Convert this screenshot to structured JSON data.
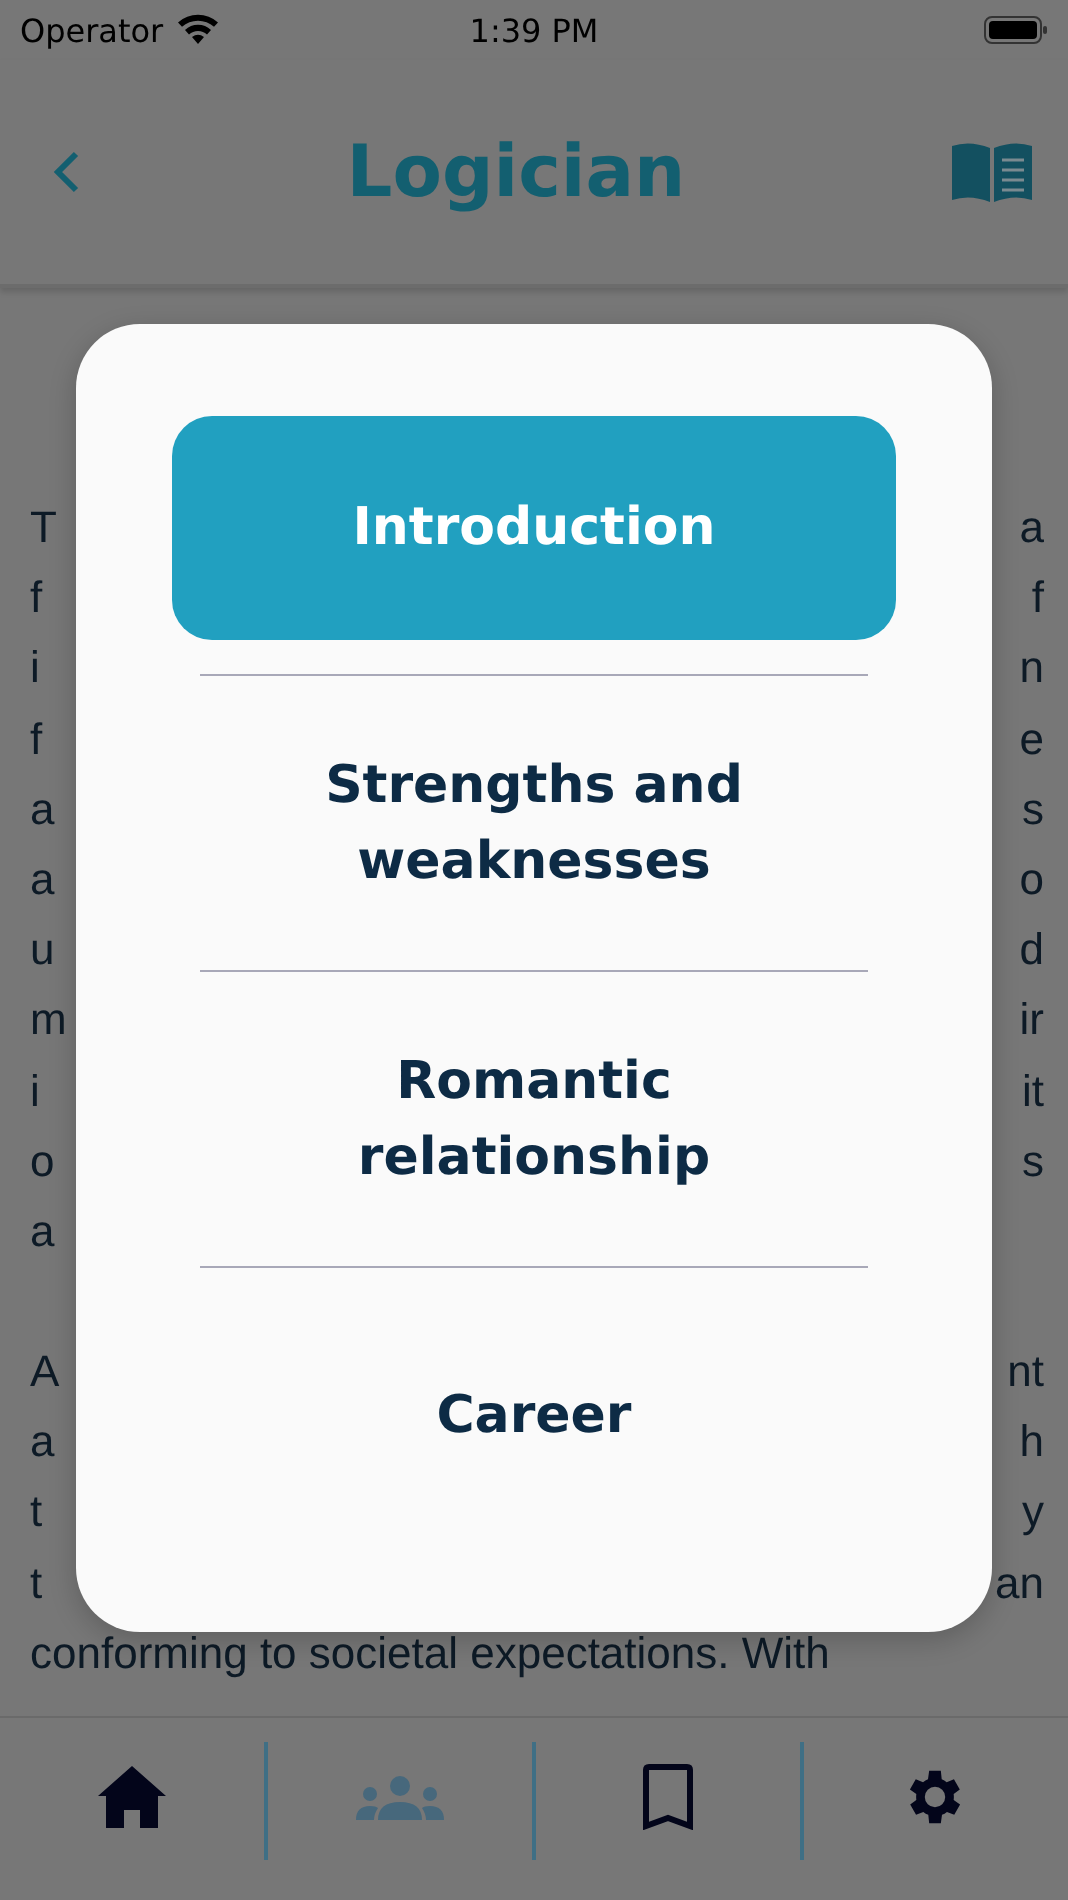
{
  "status_bar": {
    "carrier": "Operator",
    "time": "1:39 PM"
  },
  "header": {
    "title": "Logician"
  },
  "article": {
    "paragraphs": [
      {
        "lines": [
          {
            "left": "T",
            "right": "a"
          },
          {
            "left": "f",
            "right": "f"
          },
          {
            "left": "i",
            "right": "n"
          },
          {
            "left": "f",
            "right": "e"
          },
          {
            "left": "a",
            "right": "s"
          },
          {
            "left": "a",
            "right": "o"
          },
          {
            "left": "u",
            "right": "d"
          },
          {
            "left": "m",
            "right": "ir"
          },
          {
            "left": "i",
            "right": "it"
          },
          {
            "left": "o",
            "right": "s"
          },
          {
            "left": "a"
          }
        ]
      },
      {
        "lines": [
          {
            "left": "A",
            "right": "nt"
          },
          {
            "left": "a",
            "right": "h"
          },
          {
            "left": "t",
            "right": "y"
          },
          {
            "left": "t",
            "right": "an"
          },
          {
            "left": "conforming to societal expectations. With"
          }
        ]
      }
    ]
  },
  "menu": {
    "items": [
      {
        "label": "Introduction",
        "selected": true
      },
      {
        "label": "Strengths and weaknesses",
        "selected": false
      },
      {
        "label": "Romantic relationship",
        "selected": false
      },
      {
        "label": "Career",
        "selected": false
      }
    ]
  },
  "tab_bar": {
    "tabs": [
      {
        "kind": "home",
        "selected": false
      },
      {
        "kind": "people",
        "selected": true
      },
      {
        "kind": "bookmark",
        "selected": false
      },
      {
        "kind": "settings",
        "selected": false
      }
    ]
  }
}
